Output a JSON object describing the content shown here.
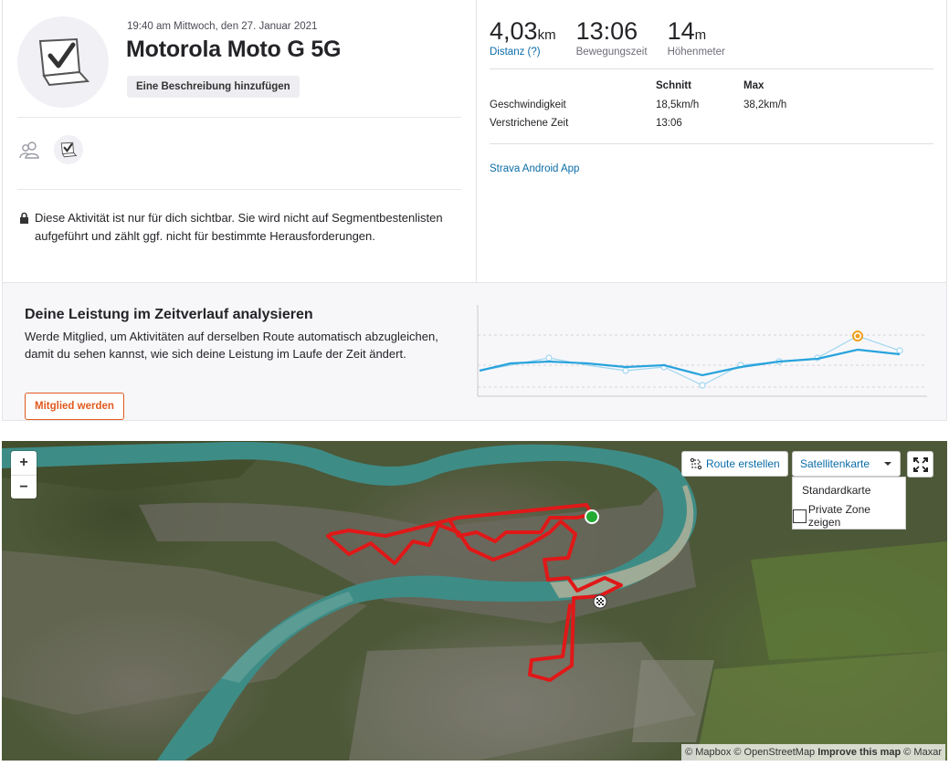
{
  "activity": {
    "timestamp": "19:40 am Mittwoch, den 27. Januar 2021",
    "title": "Motorola Moto G 5G",
    "add_description": "Eine Beschreibung hinzufügen",
    "privacy_notice": "Diese Aktivität ist nur für dich sichtbar. Sie wird nicht auf Segmentbestenlisten aufgeführt und zählt ggf. nicht für bestimmte Herausforderungen."
  },
  "stats": {
    "distance": {
      "value": "4,03",
      "unit": "km",
      "label": "Distanz (?)"
    },
    "moving_time": {
      "value": "13:06",
      "label": "Bewegungszeit"
    },
    "elevation": {
      "value": "14",
      "unit": "m",
      "label": "Höhenmeter"
    },
    "table": {
      "headers": [
        "",
        "Schnitt",
        "Max"
      ],
      "rows": [
        {
          "label": "Geschwindigkeit",
          "avg": "18,5km/h",
          "max": "38,2km/h"
        },
        {
          "label": "Verstrichene Zeit",
          "avg": "13:06",
          "max": ""
        }
      ]
    },
    "device_link": "Strava Android App"
  },
  "upsell": {
    "title": "Deine Leistung im Zeitverlauf analysieren",
    "text": "Werde Mitglied, um Aktivitäten auf derselben Route automatisch abzugleichen, damit du sehen kannst, wie sich deine Leistung im Laufe der Zeit ändert.",
    "button": "Mitglied werden"
  },
  "map": {
    "zoom_in": "+",
    "zoom_out": "−",
    "route_button": "Route erstellen",
    "map_type": "Satellitenkarte",
    "menu": {
      "standard": "Standardkarte",
      "private_zone": "Private Zone zeigen"
    },
    "attribution": {
      "mapbox": "© Mapbox",
      "osm": "© OpenStreetMap",
      "improve": "Improve this map",
      "maxar": "© Maxar"
    }
  },
  "colors": {
    "brand_orange": "#e05a1f",
    "link_blue": "#0a6ca8",
    "route_red": "#e01818",
    "chart_line": "#29a3dc"
  }
}
